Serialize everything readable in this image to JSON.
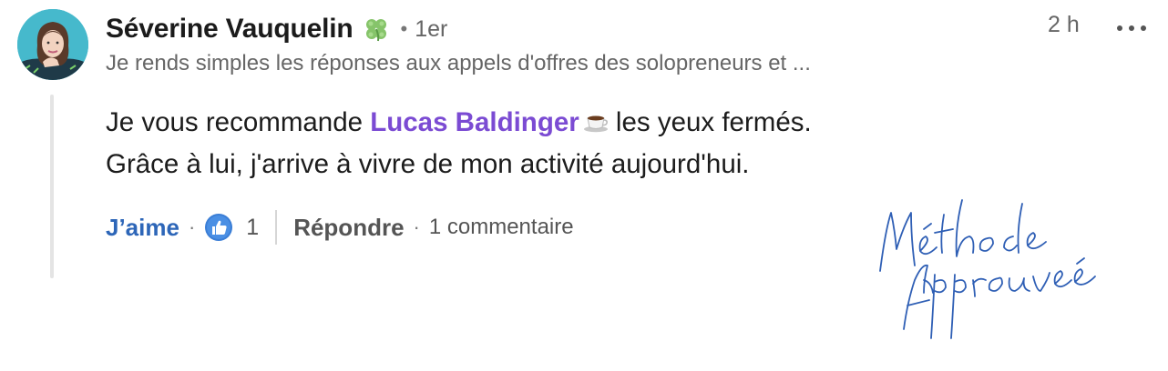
{
  "author": {
    "name": "Séverine Vauquelin",
    "badge_icon": "four-leaf-clover-icon",
    "degree": "1er",
    "headline": "Je rends simples les réponses aux appels d'offres des solopreneurs et ...",
    "separator": "•"
  },
  "timestamp": "2 h",
  "comment": {
    "line1_before": "Je vous recommande ",
    "mention": "Lucas Baldinger",
    "mention_icon": "coffee-cup-icon",
    "line1_after": " les yeux fermés.",
    "line2": "Grâce à lui, j'arrive à vivre de mon activité aujourd'hui."
  },
  "actions": {
    "like_label": "J’aime",
    "separator": "·",
    "reaction_icon": "thumbs-up-icon",
    "like_count": "1",
    "reply_label": "Répondre",
    "reply_count": "1 commentaire"
  },
  "signature_image": {
    "line1": "Méthode",
    "line2": "Approuvée"
  },
  "colors": {
    "mention": "#7b4bd3",
    "like": "#2d66b8",
    "signature": "#2f5fb5"
  }
}
